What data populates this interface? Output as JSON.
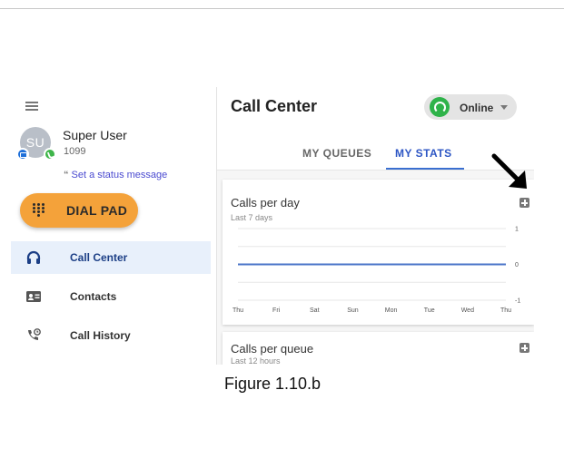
{
  "sidebar": {
    "user": {
      "initials": "SU",
      "name": "Super User",
      "extension": "1099",
      "status_message": "Set a status message"
    },
    "dialpad_label": "DIAL PAD",
    "nav": [
      {
        "label": "Call Center",
        "icon": "headset-icon",
        "active": true
      },
      {
        "label": "Contacts",
        "icon": "contact-card-icon",
        "active": false
      },
      {
        "label": "Call History",
        "icon": "phone-history-icon",
        "active": false
      }
    ]
  },
  "main": {
    "title": "Call Center",
    "status": {
      "label": "Online",
      "color": "#2fb34a"
    },
    "tabs": [
      {
        "label": "MY QUEUES",
        "active": false
      },
      {
        "label": "MY STATS",
        "active": true
      }
    ],
    "cards": [
      {
        "title": "Calls per day",
        "subtitle": "Last 7 days"
      },
      {
        "title": "Calls per queue",
        "subtitle": "Last 12 hours"
      }
    ]
  },
  "chart_data": {
    "type": "line",
    "title": "Calls per day",
    "subtitle": "Last 7 days",
    "categories": [
      "Thu",
      "Fri",
      "Sat",
      "Sun",
      "Mon",
      "Tue",
      "Wed",
      "Thu"
    ],
    "series": [
      {
        "values": [
          0,
          0,
          0,
          0,
          0,
          0,
          0,
          0
        ],
        "color": "#4a74c9"
      }
    ],
    "y_ticks": [
      "1",
      "0",
      "-1"
    ],
    "ylim": [
      -1,
      1
    ],
    "grid": true
  },
  "caption": "Figure 1.10.b",
  "colors": {
    "accent": "#2d56c4",
    "dialpad": "#f4a23a",
    "active_nav_bg": "#e8f0fb"
  }
}
